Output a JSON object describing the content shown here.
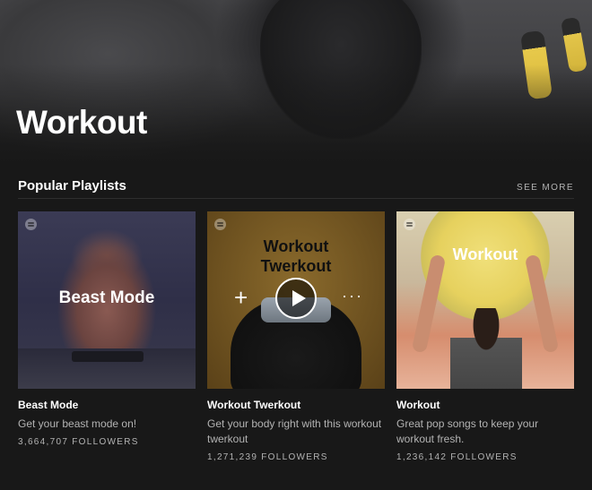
{
  "header": {
    "title": "Workout"
  },
  "section": {
    "title": "Popular Playlists",
    "see_more": "SEE MORE"
  },
  "playlists": [
    {
      "cover_text": "Beast Mode",
      "title": "Beast Mode",
      "description": "Get your beast mode on!",
      "followers": "3,664,707 FOLLOWERS"
    },
    {
      "cover_text": "Workout Twerkout",
      "title": "Workout Twerkout",
      "description": "Get your body right with this workout twerkout",
      "followers": "1,271,239 FOLLOWERS",
      "controls": {
        "add": "+",
        "more": "···"
      }
    },
    {
      "cover_text": "Workout",
      "title": "Workout",
      "description": "Great pop songs to keep your workout fresh.",
      "followers": "1,236,142 FOLLOWERS"
    }
  ],
  "colors": {
    "background": "#181818",
    "text_primary": "#ffffff",
    "text_secondary": "#b3b3b3"
  }
}
